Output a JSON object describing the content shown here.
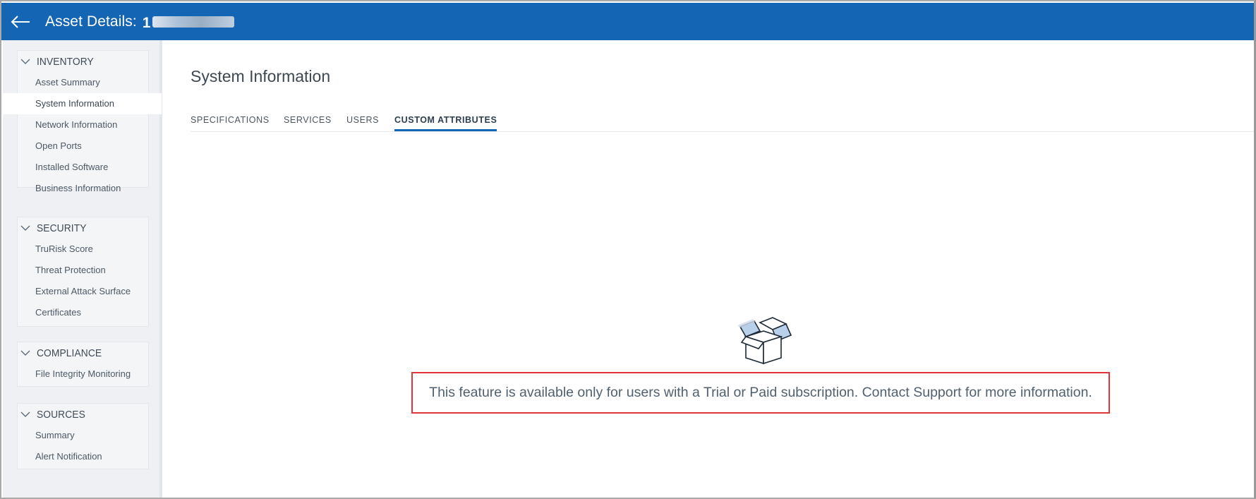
{
  "header": {
    "title": "Asset Details:",
    "asset_id_visible": "1",
    "colors": {
      "bar": "#1565b5"
    }
  },
  "sidebar": {
    "groups": [
      {
        "title": "INVENTORY",
        "items": [
          "Asset Summary",
          "System Information",
          "Network Information",
          "Open Ports",
          "Installed Software",
          "Business Information"
        ]
      },
      {
        "title": "SECURITY",
        "items": [
          "TruRisk Score",
          "Threat Protection",
          "External Attack Surface",
          "Certificates"
        ]
      },
      {
        "title": "COMPLIANCE",
        "items": [
          "File Integrity Monitoring"
        ]
      },
      {
        "title": "SOURCES",
        "items": [
          "Summary",
          "Alert Notification"
        ]
      }
    ],
    "active_item": "System Information"
  },
  "main": {
    "title": "System Information",
    "tabs": [
      {
        "label": "SPECIFICATIONS",
        "active": false
      },
      {
        "label": "SERVICES",
        "active": false
      },
      {
        "label": "USERS",
        "active": false
      },
      {
        "label": "CUSTOM ATTRIBUTES",
        "active": true
      }
    ],
    "empty_state": {
      "icon": "open-box-icon",
      "message": "This feature is available only for users with a Trial or Paid subscription. Contact Support for more information.",
      "highlight_color": "#e0363a"
    }
  }
}
